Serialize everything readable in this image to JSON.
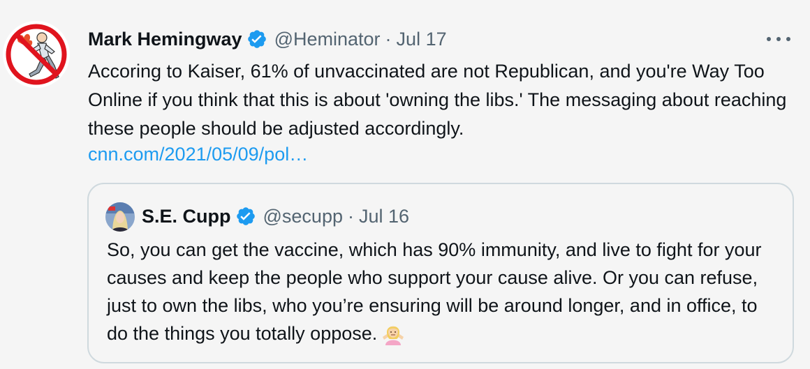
{
  "tweet": {
    "author_name": "Mark Hemingway",
    "handle": "@Heminator",
    "separator": "·",
    "date": "Jul 17",
    "text": "Accoring to Kaiser, 61% of unvaccinated are not Republican, and you're Way Too Online if you think that this is about 'owning the libs.' The messaging about reaching these people should be adjusted accordingly.",
    "link": "cnn.com/2021/05/09/pol…",
    "avatar_icon": "running-man-no-symbol-avatar",
    "verified_icon": "verified-badge-icon",
    "more_icon": "more-options-icon"
  },
  "quote": {
    "author_name": "S.E. Cupp",
    "handle": "@secupp",
    "separator": "·",
    "date": "Jul 16",
    "text": "So, you can get the vaccine, which has 90% immunity, and live to fight for your causes and keep the people who support your cause alive. Or you can refuse, just to own the libs, who you’re ensuring will be around longer, and in office, to do the things you totally oppose.",
    "emoji_icon": "person-shrugging-emoji",
    "avatar_icon": "user-photo-avatar"
  },
  "colors": {
    "background": "#f5f5f5",
    "text": "#0f1419",
    "secondary": "#536471",
    "link": "#1d9bf0",
    "verified": "#1d9bf0",
    "card_border": "#cfd9de"
  }
}
